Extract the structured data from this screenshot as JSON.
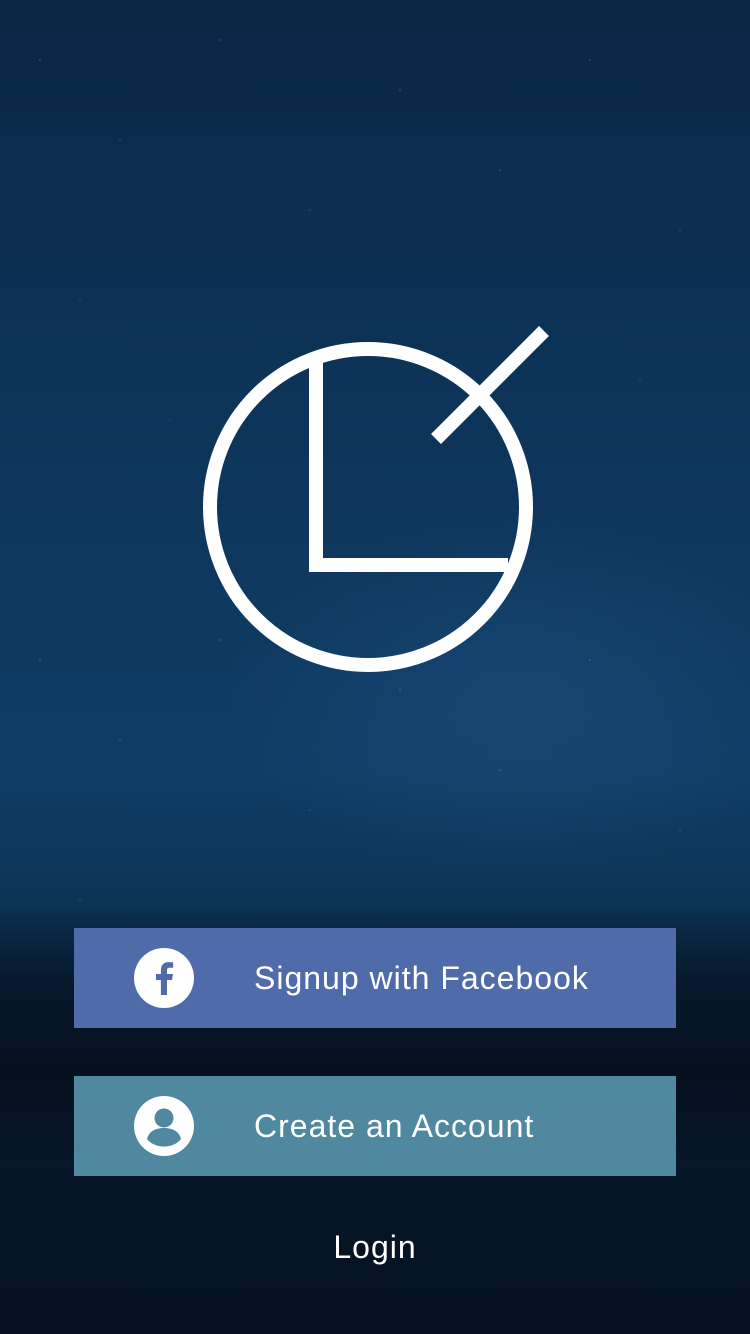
{
  "logo": {
    "icon": "clock-logo-icon",
    "color": "#ffffff"
  },
  "buttons": {
    "facebook": {
      "label": "Signup with Facebook",
      "icon": "facebook-icon",
      "color": "#4f6ba9"
    },
    "create_account": {
      "label": "Create an Account",
      "icon": "user-icon",
      "color": "#4f889f"
    }
  },
  "login": {
    "label": "Login"
  }
}
